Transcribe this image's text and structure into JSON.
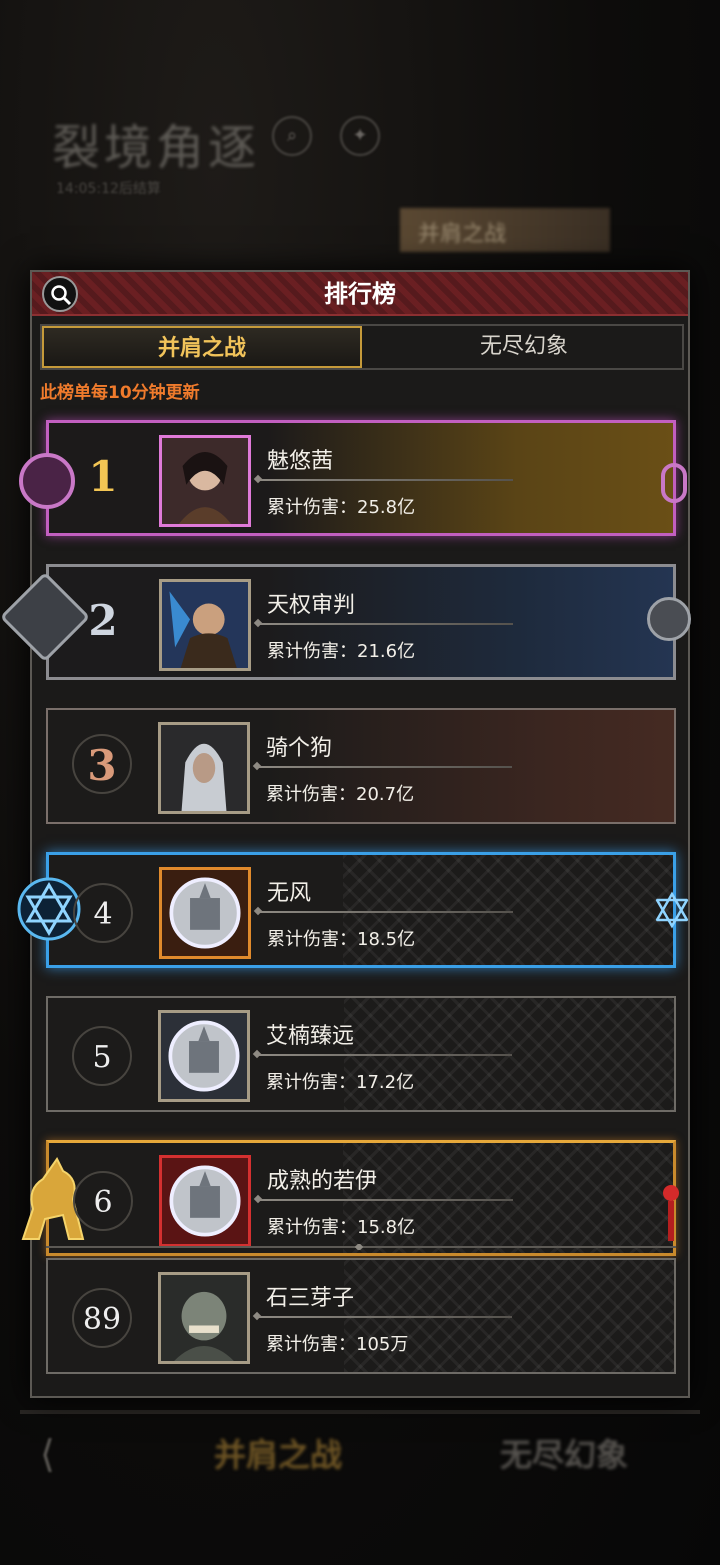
{
  "background": {
    "title": "裂境角逐",
    "subtitle": "14:05:12后结算",
    "tag": "并肩之战",
    "bottom_tabs": [
      "并肩之战",
      "无尽幻象"
    ],
    "title_icons": [
      "search-icon",
      "hint-icon"
    ]
  },
  "panel": {
    "title": "排行榜",
    "tabs": [
      {
        "label": "并肩之战",
        "active": true
      },
      {
        "label": "无尽幻象",
        "active": false
      }
    ],
    "update_note": "此榜单每10分钟更新"
  },
  "rows": [
    {
      "rank": "1",
      "name": "魅悠茜",
      "damage": "累计伤害：25.8亿"
    },
    {
      "rank": "2",
      "name": "天权审判",
      "damage": "累计伤害：21.6亿"
    },
    {
      "rank": "3",
      "name": "骑个狗",
      "damage": "累计伤害：20.7亿"
    },
    {
      "rank": "4",
      "name": "无风",
      "damage": "累计伤害：18.5亿"
    },
    {
      "rank": "5",
      "name": "艾楠臻远",
      "damage": "累计伤害：17.2亿"
    },
    {
      "rank": "6",
      "name": "成熟的若伊",
      "damage": "累计伤害：15.8亿"
    }
  ],
  "my_row": {
    "rank": "89",
    "name": "石三芽子",
    "damage": "累计伤害：105万"
  },
  "colors": {
    "accent_gold": "#f1c35a",
    "header_red": "#6a1f22",
    "note_orange": "#f07b2c",
    "rank1_frame": "#c25fc0",
    "rank4_frame": "#3aa0e8"
  }
}
